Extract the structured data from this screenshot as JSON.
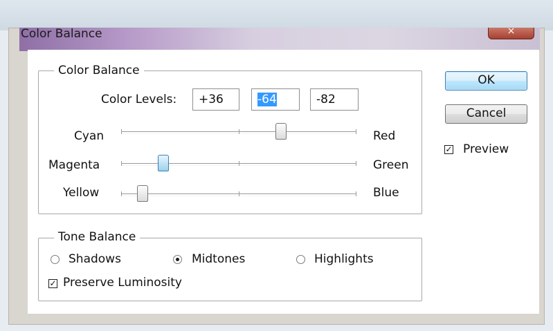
{
  "window": {
    "title": "Color Balance",
    "close_glyph": "×"
  },
  "color_balance": {
    "group_label": "Color Balance",
    "levels_label": "Color Levels:",
    "levels": [
      "+36",
      "-64",
      "-82"
    ],
    "sliders": [
      {
        "left": "Cyan",
        "right": "Red",
        "value": 36
      },
      {
        "left": "Magenta",
        "right": "Green",
        "value": -64
      },
      {
        "left": "Yellow",
        "right": "Blue",
        "value": -82
      }
    ]
  },
  "tone_balance": {
    "group_label": "Tone Balance",
    "options": [
      {
        "label": "Shadows",
        "checked": false
      },
      {
        "label": "Midtones",
        "checked": true
      },
      {
        "label": "Highlights",
        "checked": false
      }
    ],
    "preserve_luminosity": {
      "label": "Preserve Luminosity",
      "checked": true
    }
  },
  "buttons": {
    "ok": "OK",
    "cancel": "Cancel"
  },
  "preview": {
    "label": "Preview",
    "checked": true
  },
  "check_glyph": "✓"
}
